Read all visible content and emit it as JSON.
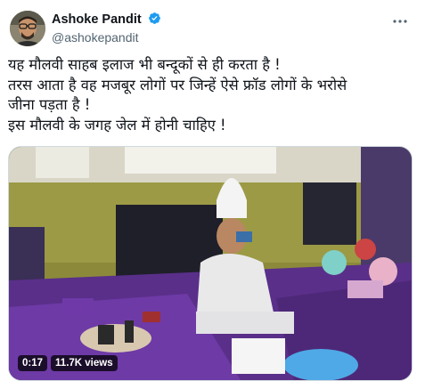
{
  "author": {
    "display_name": "Ashoke Pandit",
    "handle": "@ashokepandit",
    "verified": true
  },
  "icons": {
    "avatar": "avatar",
    "verified": "verified-badge-icon",
    "more": "more-options-icon"
  },
  "tweet": {
    "lines": [
      "यह मौलवी साहब इलाज भी बन्दूकों से ही करता है !",
      "तरस आता है वह मजबूर लोगों पर जिन्हें ऐसे फ्रॉड लोगों के भरोसे",
      "जीना पड़ता है !",
      "इस मौलवी के जगह जेल में होनी चाहिए !"
    ]
  },
  "video": {
    "duration": "0:17",
    "views": "11.7K views"
  },
  "colors": {
    "verified": "#1d9bf0",
    "secondary_text": "#536471",
    "border": "#cfd9de"
  }
}
